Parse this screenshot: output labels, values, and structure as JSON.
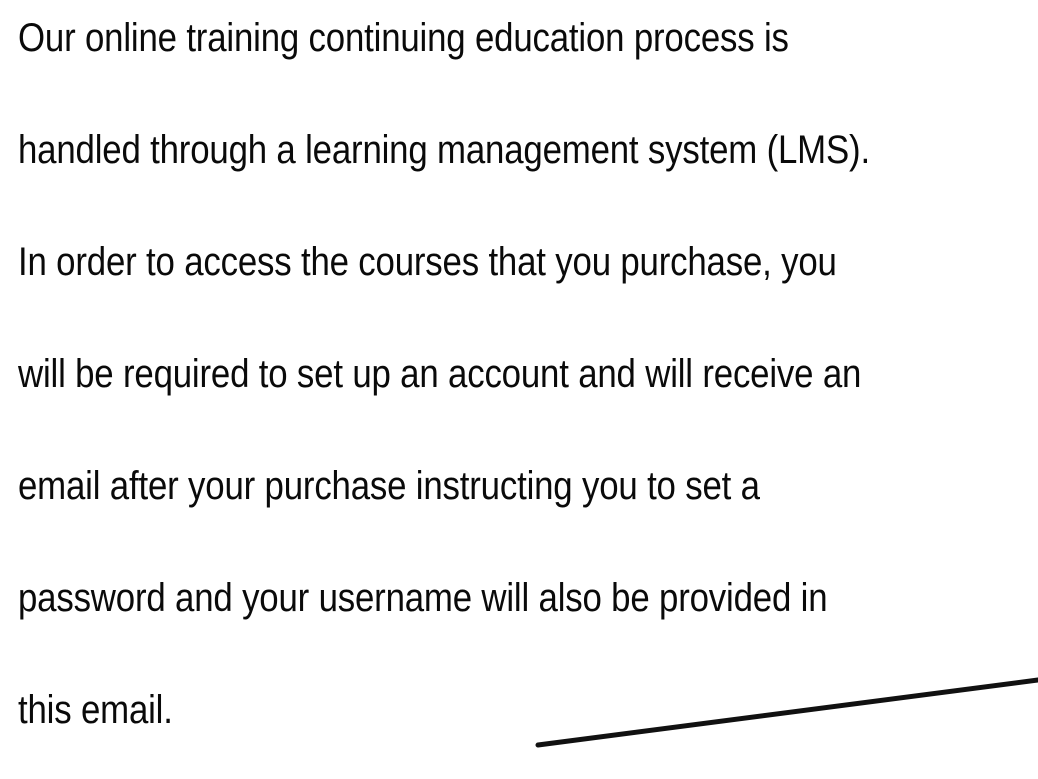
{
  "document": {
    "lines": [
      "Our online training continuing education process is",
      "handled through a learning management system (LMS).",
      "In order to access the courses that you purchase, you",
      "will be required to set up an account and will receive an",
      "email after your purchase instructing you to set a",
      "password and your username will also be provided in",
      "this email."
    ],
    "text_color": "#0a0a0a",
    "stroke_color": "#111111"
  }
}
